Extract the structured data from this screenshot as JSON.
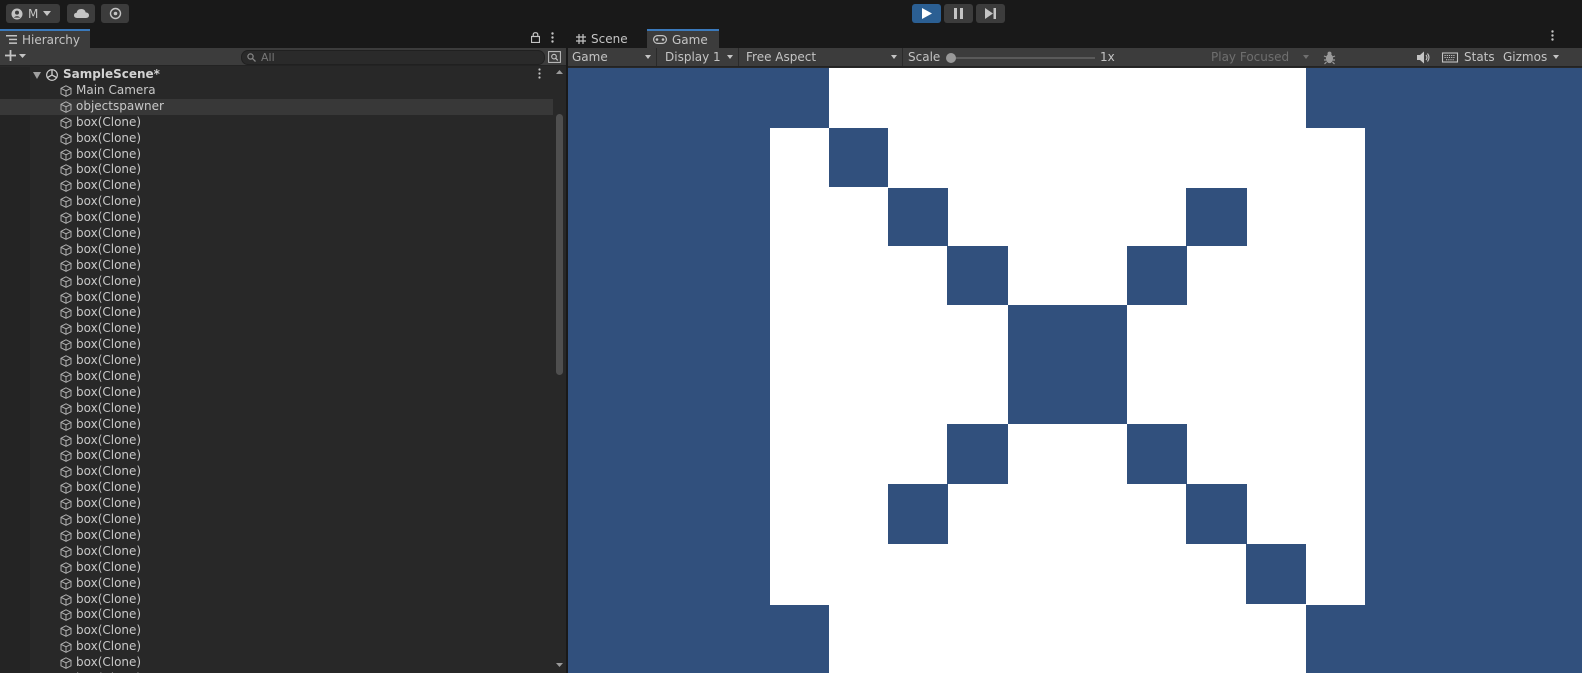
{
  "toolbar": {
    "account_label": "M",
    "play_active": true
  },
  "hierarchy": {
    "tab_label": "Hierarchy",
    "search_placeholder": "All",
    "scene_name": "SampleScene*",
    "items": [
      {
        "label": "Main Camera",
        "selected": false
      },
      {
        "label": "objectspawner",
        "selected": true
      },
      {
        "label": "box(Clone)"
      },
      {
        "label": "box(Clone)"
      },
      {
        "label": "box(Clone)"
      },
      {
        "label": "box(Clone)"
      },
      {
        "label": "box(Clone)"
      },
      {
        "label": "box(Clone)"
      },
      {
        "label": "box(Clone)"
      },
      {
        "label": "box(Clone)"
      },
      {
        "label": "box(Clone)"
      },
      {
        "label": "box(Clone)"
      },
      {
        "label": "box(Clone)"
      },
      {
        "label": "box(Clone)"
      },
      {
        "label": "box(Clone)"
      },
      {
        "label": "box(Clone)"
      },
      {
        "label": "box(Clone)"
      },
      {
        "label": "box(Clone)"
      },
      {
        "label": "box(Clone)"
      },
      {
        "label": "box(Clone)"
      },
      {
        "label": "box(Clone)"
      },
      {
        "label": "box(Clone)"
      },
      {
        "label": "box(Clone)"
      },
      {
        "label": "box(Clone)"
      },
      {
        "label": "box(Clone)"
      },
      {
        "label": "box(Clone)"
      },
      {
        "label": "box(Clone)"
      },
      {
        "label": "box(Clone)"
      },
      {
        "label": "box(Clone)"
      },
      {
        "label": "box(Clone)"
      },
      {
        "label": "box(Clone)"
      },
      {
        "label": "box(Clone)"
      },
      {
        "label": "box(Clone)"
      },
      {
        "label": "box(Clone)"
      },
      {
        "label": "box(Clone)"
      },
      {
        "label": "box(Clone)"
      },
      {
        "label": "box(Clone)"
      },
      {
        "label": "box(Clone)"
      }
    ]
  },
  "game": {
    "tabs": {
      "scene": "Scene",
      "game": "Game"
    },
    "view_mode": "Game",
    "display": "Display 1",
    "aspect": "Free Aspect",
    "scale_label": "Scale",
    "scale_value": "1x",
    "play_mode_option": "Play Focused",
    "stats_label": "Stats",
    "gizmos_label": "Gizmos",
    "colors": {
      "background": "#31507d",
      "box": "#ffffff"
    }
  }
}
